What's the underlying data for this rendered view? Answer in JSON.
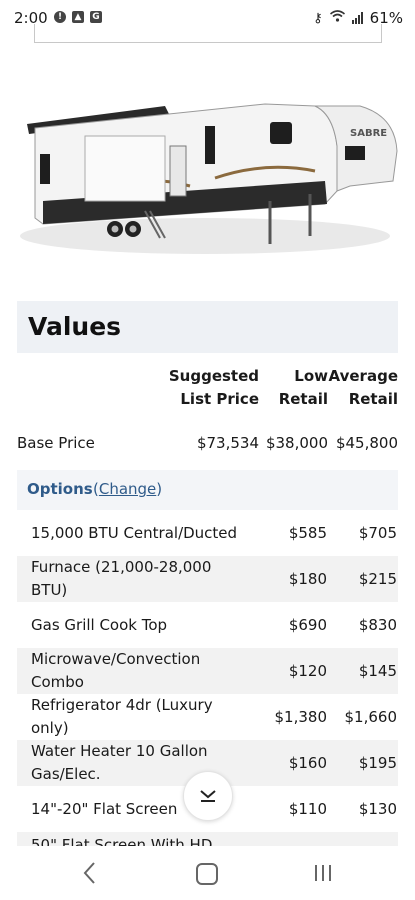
{
  "status_bar": {
    "time": "2:00",
    "battery": "61%",
    "left_icons": [
      "alert-icon",
      "image-icon",
      "gallery-icon"
    ]
  },
  "values": {
    "title": "Values",
    "columns": {
      "suggested": [
        "Suggested",
        "List Price"
      ],
      "low": [
        "Low",
        "Retail"
      ],
      "average": [
        "Average",
        "Retail"
      ]
    },
    "base": {
      "label": "Base Price",
      "suggested": "$73,534",
      "low": "$38,000",
      "average": "$45,800"
    }
  },
  "options": {
    "label": "Options",
    "change_open": "(",
    "change_link": "Change",
    "change_close": ")",
    "rows": [
      {
        "name": "15,000 BTU Central/Ducted",
        "low": "$585",
        "avg": "$705"
      },
      {
        "name": "Furnace (21,000-28,000 BTU)",
        "low": "$180",
        "avg": "$215"
      },
      {
        "name": "Gas Grill Cook Top",
        "low": "$690",
        "avg": "$830"
      },
      {
        "name": "Microwave/Convection Combo",
        "low": "$120",
        "avg": "$145"
      },
      {
        "name": "Refrigerator 4dr (Luxury only)",
        "low": "$1,380",
        "avg": "$1,660"
      },
      {
        "name": "Water Heater 10 Gallon Gas/Elec.",
        "low": "$160",
        "avg": "$195"
      },
      {
        "name": "14\"-20\" Flat Screen",
        "low": "$110",
        "avg": "$130"
      },
      {
        "name": "50\" Flat Screen With HD",
        "low": "",
        "avg": ""
      }
    ]
  },
  "colors": {
    "accent": "#2f5b8a",
    "header_bg": "#eef1f5",
    "row_alt": "#f2f2f2"
  },
  "rv_brand": "SABRE"
}
